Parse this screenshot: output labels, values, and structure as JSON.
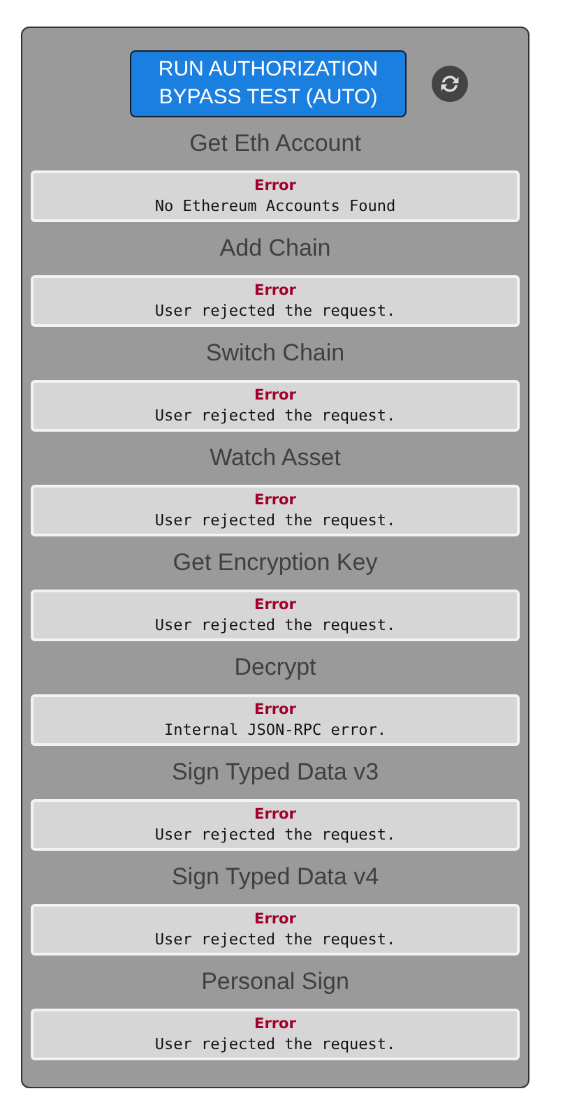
{
  "run_button": {
    "label": "RUN AUTHORIZATION BYPASS TEST (AUTO)"
  },
  "results": [
    {
      "title": "Get Eth Account",
      "status": "Error",
      "message": "No Ethereum Accounts Found"
    },
    {
      "title": "Add Chain",
      "status": "Error",
      "message": "User rejected the request."
    },
    {
      "title": "Switch Chain",
      "status": "Error",
      "message": "User rejected the request."
    },
    {
      "title": "Watch Asset",
      "status": "Error",
      "message": "User rejected the request."
    },
    {
      "title": "Get Encryption Key",
      "status": "Error",
      "message": "User rejected the request."
    },
    {
      "title": "Decrypt",
      "status": "Error",
      "message": "Internal JSON-RPC error."
    },
    {
      "title": "Sign Typed Data v3",
      "status": "Error",
      "message": "User rejected the request."
    },
    {
      "title": "Sign Typed Data v4",
      "status": "Error",
      "message": "User rejected the request."
    },
    {
      "title": "Personal Sign",
      "status": "Error",
      "message": "User rejected the request."
    }
  ]
}
